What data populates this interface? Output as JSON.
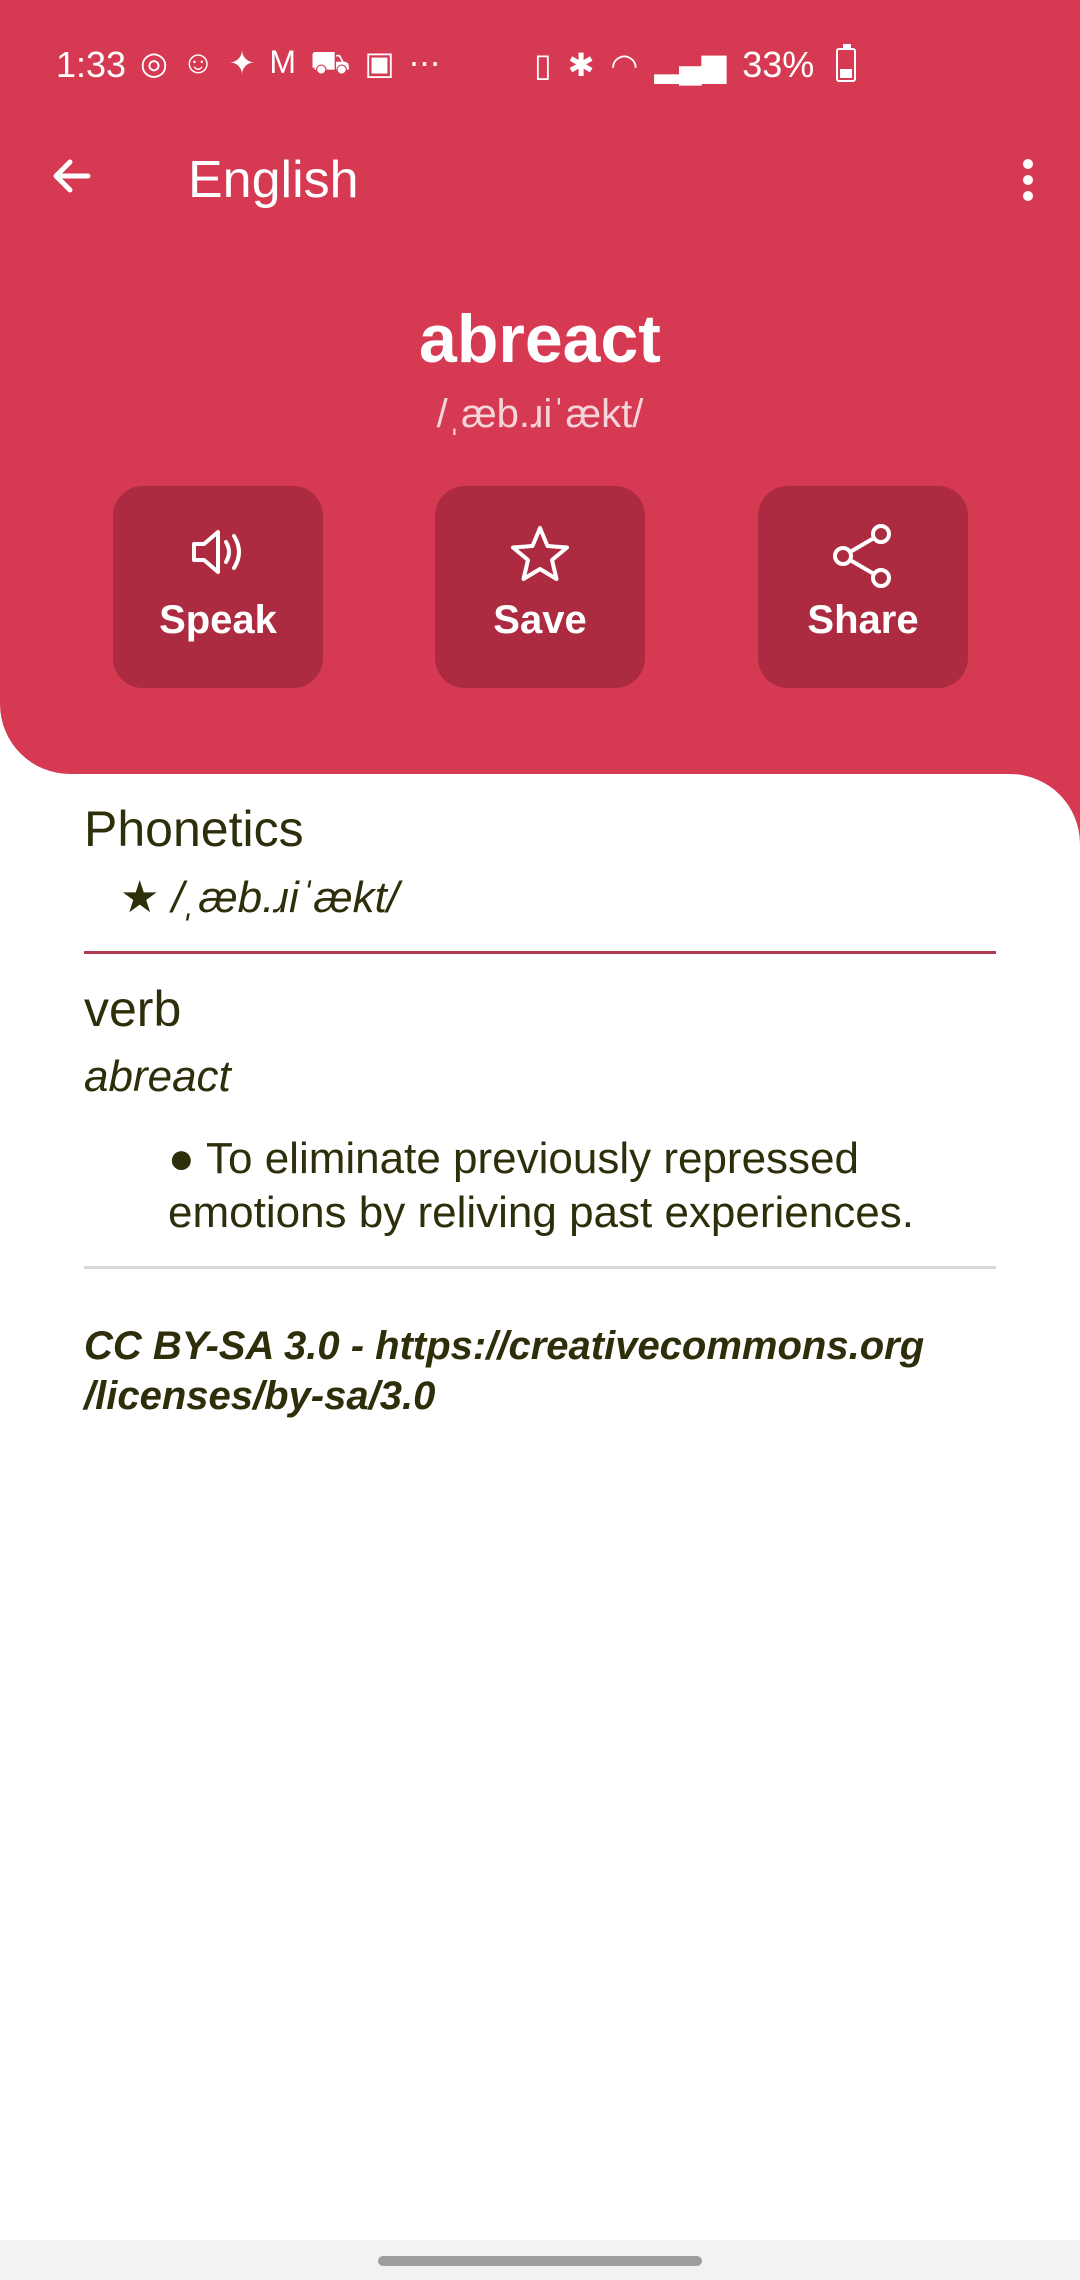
{
  "status_bar": {
    "time": "1:33",
    "battery": "33%"
  },
  "app_bar": {
    "title": "English"
  },
  "entry": {
    "word": "abreact",
    "phonetic": "/ˌæb.ɹiˈækt/"
  },
  "actions": {
    "speak": "Speak",
    "save": "Save",
    "share": "Share"
  },
  "phonetics_section": {
    "title": "Phonetics",
    "items": [
      "★ /ˌæb.ɹiˈækt/"
    ]
  },
  "meaning": {
    "part_of_speech": "verb",
    "word": "abreact",
    "definition": "● To eliminate previously repressed emotions by reliving past experiences."
  },
  "license": {
    "text_line1": "CC BY-SA 3.0 - https://creativecommons.org",
    "text_line2": "/licenses/by-sa/3.0"
  },
  "colors": {
    "accent": "#d63952",
    "button_bg": "#ad2b40",
    "text": "#2e2e0a"
  }
}
